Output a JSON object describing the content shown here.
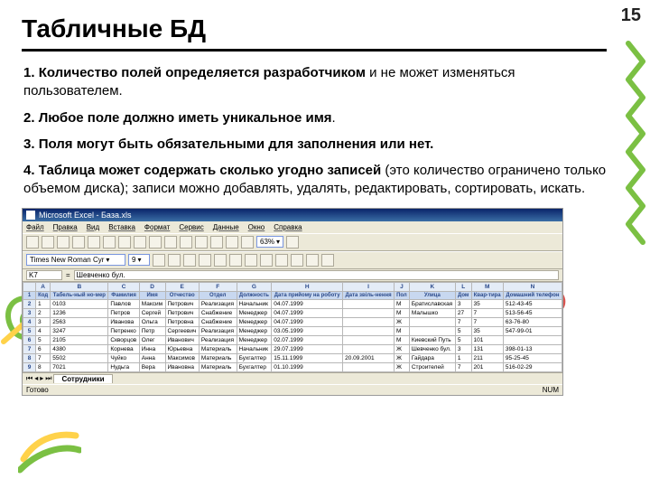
{
  "page_number": "15",
  "title": "Табличные БД",
  "points": [
    {
      "num": "1.",
      "bold": "Количество полей определяется разработчиком",
      "rest": " и не может изменяться пользователем."
    },
    {
      "num": "2.",
      "bold": "Любое поле должно иметь уникальное имя",
      "rest": "."
    },
    {
      "num": "3.",
      "bold": "Поля могут быть обязательными для заполнения или нет.",
      "rest": ""
    },
    {
      "num": "4.",
      "bold": "Таблица может содержать сколько угодно записей",
      "rest": " (это количество ограничено только объемом диска); записи можно добавлять, удалять, редактировать, сортировать, искать."
    }
  ],
  "excel": {
    "title": "Microsoft Excel - База.xls",
    "menu": [
      "Файл",
      "Правка",
      "Вид",
      "Вставка",
      "Формат",
      "Сервис",
      "Данные",
      "Окно",
      "Справка"
    ],
    "font_name": "Times New Roman Cyr",
    "font_size": "9",
    "zoom": "63%",
    "cell_ref": "K7",
    "formula_value": "Шевченко бул.",
    "col_letters": [
      "",
      "A",
      "B",
      "C",
      "D",
      "E",
      "F",
      "G",
      "H",
      "I",
      "J",
      "K",
      "L",
      "M",
      "N"
    ],
    "headers": [
      "Код",
      "Табель-ный но-мер",
      "Фамилия",
      "Имя",
      "Отчество",
      "Отдел",
      "Должность",
      "Дата прийому на роботу",
      "Дата звіль-нення",
      "Пол",
      "Улица",
      "Дом",
      "Квар-тира",
      "Домашний телефон"
    ],
    "rows": [
      [
        "2",
        "1",
        "0103",
        "Павлов",
        "Максим",
        "Петрович",
        "Реализация",
        "Начальник",
        "04.07.1999",
        "",
        "М",
        "Братиславская",
        "3",
        "35",
        "512-43-45"
      ],
      [
        "3",
        "2",
        "1236",
        "Петров",
        "Сергей",
        "Петрович",
        "Снабжение",
        "Менеджер",
        "04.07.1999",
        "",
        "М",
        "Малышко",
        "27",
        "7",
        "513-56-45"
      ],
      [
        "4",
        "3",
        "2563",
        "Иванова",
        "Ольга",
        "Петровна",
        "Снабжение",
        "Менеджер",
        "04.07.1999",
        "",
        "Ж",
        "",
        "7",
        "7",
        "63-76-80"
      ],
      [
        "5",
        "4",
        "3247",
        "Петренко",
        "Петр",
        "Сергеевич",
        "Реализация",
        "Менеджер",
        "03.05.1999",
        "",
        "М",
        "",
        "5",
        "35",
        "547-99-01"
      ],
      [
        "6",
        "5",
        "2105",
        "Скворцов",
        "Олег",
        "Иванович",
        "Реализация",
        "Менеджер",
        "02.07.1999",
        "",
        "М",
        "Киевский Путь",
        "5",
        "101",
        "",
        "",
        ""
      ],
      [
        "7",
        "6",
        "4380",
        "Корнева",
        "Инна",
        "Юрьевна",
        "Материаль",
        "Начальник",
        "29.07.1999",
        "",
        "Ж",
        "Шевченко бул.",
        "3",
        "131",
        "398-01-13"
      ],
      [
        "8",
        "7",
        "5502",
        "Чуйко",
        "Анна",
        "Максимов",
        "Материаль",
        "Бухгалтер",
        "15.11.1999",
        "20.09.2001",
        "Ж",
        "Гайдара",
        "1",
        "211",
        "95-25-45"
      ],
      [
        "9",
        "8",
        "7021",
        "Нудьга",
        "Вера",
        "Ивановна",
        "Материаль",
        "Бухгалтер",
        "01.10.1999",
        "",
        "Ж",
        "Строителей",
        "7",
        "201",
        "516-02-29"
      ]
    ],
    "sheet_tab": "Сотрудники",
    "status_left": "Готово",
    "status_right": "NUM"
  }
}
